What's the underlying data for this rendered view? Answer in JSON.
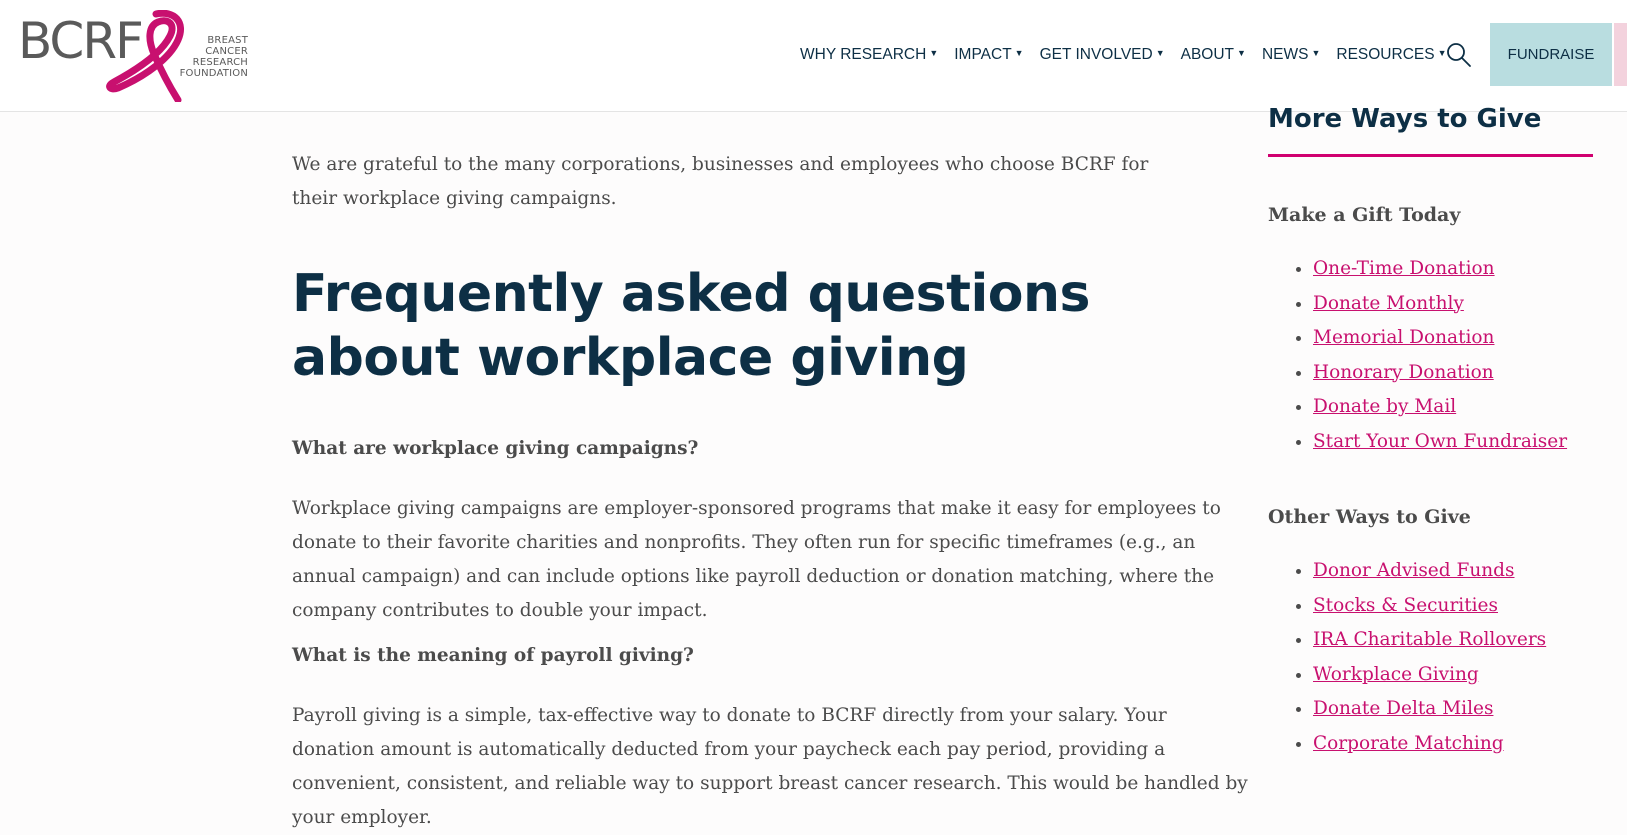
{
  "header": {
    "logo": {
      "letters": "BCRF",
      "sub": [
        "BREAST",
        "CANCER",
        "RESEARCH",
        "FOUNDATION"
      ]
    },
    "nav": [
      {
        "label": "WHY RESEARCH"
      },
      {
        "label": "IMPACT"
      },
      {
        "label": "GET INVOLVED"
      },
      {
        "label": "ABOUT"
      },
      {
        "label": "NEWS"
      },
      {
        "label": "RESOURCES"
      }
    ],
    "search_icon": "search-icon",
    "fundraise_label": "FUNDRAISE"
  },
  "main": {
    "intro": "We are grateful to the many corporations, businesses and employees who choose BCRF for their workplace giving campaigns.",
    "faq_title": "Frequently asked questions about workplace giving",
    "faqs": [
      {
        "q": "What are workplace giving campaigns?",
        "a": "Workplace giving campaigns are employer-sponsored programs that make it easy for employees to donate to their favorite charities and nonprofits. They often run for specific timeframes (e.g., an annual campaign) and can include options like payroll deduction or donation matching, where the company contributes to double your impact."
      },
      {
        "q": "What is the meaning of payroll giving?",
        "a": "Payroll giving is a simple, tax-effective way to donate to BCRF directly from your salary. Your donation amount is automatically deducted from your paycheck each pay period, providing a convenient, consistent, and reliable way to support breast cancer research. This would be handled by your employer."
      }
    ]
  },
  "sidebar": {
    "title": "More Ways to Give",
    "groups": [
      {
        "title": "Make a Gift Today",
        "links": [
          "One-Time Donation",
          "Donate Monthly",
          "Memorial Donation",
          "Honorary Donation",
          "Donate by Mail",
          "Start Your Own Fundraiser"
        ]
      },
      {
        "title": "Other Ways to Give",
        "links": [
          "Donor Advised Funds",
          "Stocks & Securities",
          "IRA Charitable Rollovers",
          "Workplace Giving",
          "Donate Delta Miles",
          "Corporate Matching"
        ]
      }
    ]
  },
  "colors": {
    "navy": "#0d2f45",
    "pink": "#c8106f",
    "teal_button": "#b9dde0",
    "body_text": "#4b4b4b"
  }
}
